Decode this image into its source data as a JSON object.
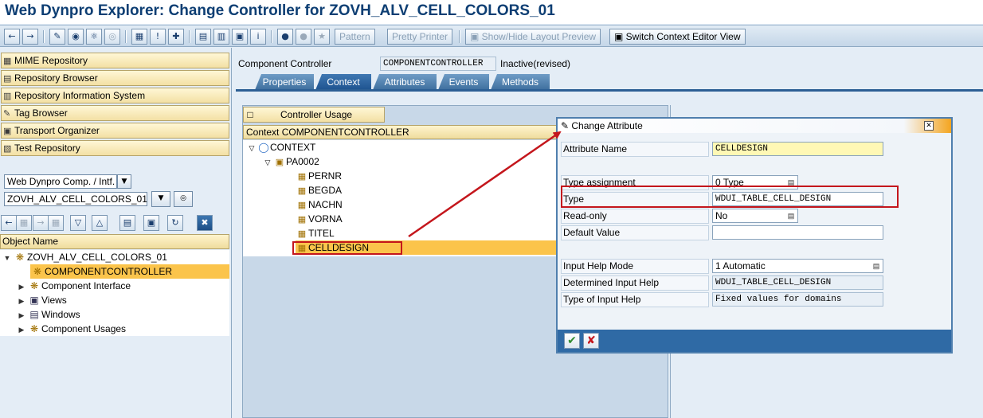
{
  "window": {
    "title": "Web Dynpro Explorer: Change Controller for ZOVH_ALV_CELL_COLORS_01"
  },
  "toolbar": {
    "icons": [
      "back-icon",
      "forward-icon",
      "edit-icon",
      "other-object-icon",
      "activate-icon",
      "where-used-icon",
      "display-object-list-icon",
      "info-icon",
      "navigate-icon",
      "hierarchy-icon",
      "inactive-objects-icon",
      "window-icon",
      "help-icon",
      "breakpoint-icon",
      "external-breakpoint-icon",
      "wizard-icon"
    ],
    "pattern_label": "Pattern",
    "pretty_printer_label": "Pretty Printer",
    "layout_preview_label": "Show/Hide Layout Preview",
    "switch_context_label": "Switch Context Editor View"
  },
  "sidebar": {
    "nav": [
      {
        "label": "MIME Repository",
        "icon": "mime-icon"
      },
      {
        "label": "Repository Browser",
        "icon": "repository-icon"
      },
      {
        "label": "Repository Information System",
        "icon": "info-system-icon"
      },
      {
        "label": "Tag Browser",
        "icon": "tag-icon"
      },
      {
        "label": "Transport Organizer",
        "icon": "transport-icon"
      },
      {
        "label": "Test Repository",
        "icon": "test-icon"
      }
    ],
    "object_type": "Web Dynpro Comp. / Intf.",
    "object_value": "ZOVH_ALV_CELL_COLORS_01",
    "object_name_header": "Object Name",
    "tree": [
      {
        "label": "ZOVH_ALV_CELL_COLORS_01",
        "icon": "component-icon"
      },
      {
        "label": "COMPONENTCONTROLLER",
        "icon": "controller-icon"
      },
      {
        "label": "Component Interface",
        "icon": "interface-icon"
      },
      {
        "label": "Views",
        "icon": "views-icon"
      },
      {
        "label": "Windows",
        "icon": "windows-icon"
      },
      {
        "label": "Component Usages",
        "icon": "usages-icon"
      }
    ]
  },
  "main": {
    "component_label": "Component Controller",
    "component_value": "COMPONENTCONTROLLER",
    "status": "Inactive(revised)",
    "tabs": [
      {
        "label": "Properties"
      },
      {
        "label": "Context"
      },
      {
        "label": "Attributes"
      },
      {
        "label": "Events"
      },
      {
        "label": "Methods"
      }
    ],
    "controller_usage_label": "Controller Usage",
    "context_header": "Context COMPONENTCONTROLLER",
    "context_tree": [
      {
        "label": "CONTEXT"
      },
      {
        "label": "PA0002"
      },
      {
        "label": "PERNR"
      },
      {
        "label": "BEGDA"
      },
      {
        "label": "NACHN"
      },
      {
        "label": "VORNA"
      },
      {
        "label": "TITEL"
      },
      {
        "label": "CELLDESIGN"
      }
    ]
  },
  "dialog": {
    "title": "Change Attribute",
    "fields": {
      "attribute_name": {
        "label": "Attribute Name",
        "value": "CELLDESIGN"
      },
      "type_assignment": {
        "label": "Type assignment",
        "value": "0 Type"
      },
      "type": {
        "label": "Type",
        "value": "WDUI_TABLE_CELL_DESIGN"
      },
      "read_only": {
        "label": "Read-only",
        "value": "No"
      },
      "default_value": {
        "label": "Default Value",
        "value": ""
      },
      "input_help_mode": {
        "label": "Input Help Mode",
        "value": "1 Automatic"
      },
      "determined_input_help": {
        "label": "Determined Input Help",
        "value": "WDUI_TABLE_CELL_DESIGN"
      },
      "type_of_input_help": {
        "label": "Type of Input Help",
        "value": "Fixed values for domains"
      }
    },
    "ok_icon": "checkmark-icon",
    "cancel_icon": "cancel-x-icon"
  },
  "colors": {
    "title_text": "#0d3e73",
    "tab_blue": "#3e6f9e",
    "highlight": "#fbc44b",
    "annotation_red": "#c4161c",
    "dialog_footer": "#2f6aa5"
  }
}
